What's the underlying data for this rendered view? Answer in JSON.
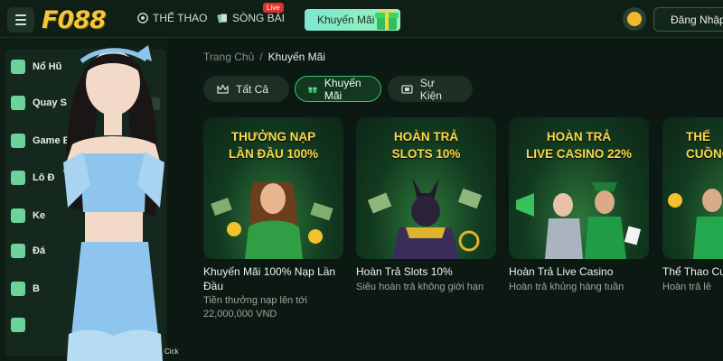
{
  "header": {
    "logo_text": "F088",
    "nav": [
      {
        "label": "THỂ THAO",
        "icon": "soccer-ball-icon"
      },
      {
        "label": "SÒNG BÀI",
        "icon": "cards-icon",
        "badge": "Live"
      }
    ],
    "promo_button": "Khuyến Mãi",
    "login_button": "Đăng Nhập"
  },
  "sidebar": {
    "items": [
      {
        "label": "Nổ Hũ",
        "icon": "slot-icon"
      },
      {
        "label": "Quay S",
        "icon": "wheel-icon"
      },
      {
        "label": "Game B",
        "icon": "game-icon"
      },
      {
        "label": "Lô Đ",
        "icon": "lottery-icon"
      },
      {
        "label": "Ke",
        "icon": "keno-icon"
      },
      {
        "label": "Đá",
        "icon": "rooster-icon"
      },
      {
        "label": "B",
        "icon": "fish-icon"
      },
      {
        "label": "",
        "icon": "dots-icon"
      }
    ],
    "footer_text": "Cick"
  },
  "breadcrumb": {
    "home": "Trang Chủ",
    "separator": "/",
    "current": "Khuyến Mãi"
  },
  "tabs": [
    {
      "label": "Tất Cả",
      "icon": "crown-icon",
      "active": false
    },
    {
      "label": "Khuyến Mãi",
      "icon": "gift-icon",
      "active": true
    },
    {
      "label": "Sự Kiện",
      "icon": "ticket-icon",
      "active": false
    }
  ],
  "cards": [
    {
      "title_line1": "THƯỞNG NẠP",
      "title_line2": "LẦN ĐẦU 100%",
      "caption": "Khuyến Mãi 100% Nạp Lần Đầu",
      "sub": "Tiền thưởng nạp lên tới",
      "sub2": "22,000,000 VND"
    },
    {
      "title_line1": "HOÀN TRẢ",
      "title_line2": "SLOTS 10%",
      "caption": "Hoàn Trả Slots 10%",
      "sub": "Siêu hoàn trả không giới hạn",
      "sub2": ""
    },
    {
      "title_line1": "HOÀN TRẢ",
      "title_line2": "LIVE CASINO 22%",
      "caption": "Hoàn Trả Live Casino",
      "sub": "Hoàn trả khủng hàng tuần",
      "sub2": ""
    },
    {
      "title_line1": "THỂ",
      "title_line2": "CUỒNG",
      "caption": "Thể Thao Cu",
      "sub": "Hoàn trả lê",
      "sub2": ""
    }
  ],
  "colors": {
    "accent": "#3ac06a",
    "title_gold": "#ffd74a",
    "background": "#0c1912"
  }
}
